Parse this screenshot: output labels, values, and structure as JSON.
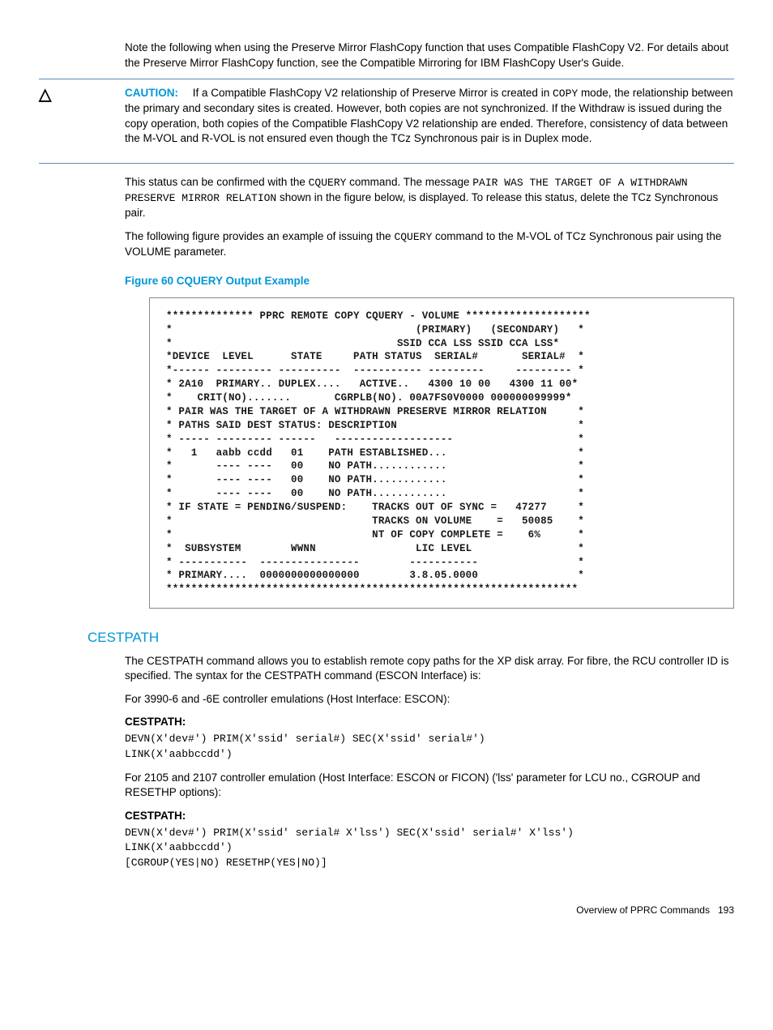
{
  "intro_para": "Note the following when using the Preserve Mirror FlashCopy function that uses Compatible FlashCopy V2. For details about the Preserve Mirror FlashCopy function, see the Compatible Mirroring for IBM FlashCopy User's Guide.",
  "caution": {
    "label": "CAUTION:",
    "pre_text": "If a Compatible FlashCopy V2 relationship of Preserve Mirror is created in ",
    "code": "COPY",
    "post_text": " mode, the relationship between the primary and secondary sites is created. However, both copies are not synchronized. If the Withdraw is issued during the copy operation, both copies of the Compatible FlashCopy V2 relationship are ended. Therefore, consistency of data between the M-VOL and R-VOL is not ensured even though the TCz Synchronous pair is in Duplex mode."
  },
  "status_para": {
    "t1": "This status can be confirmed with the ",
    "c1": "CQUERY",
    "t2": " command. The message ",
    "c2": "PAIR WAS THE TARGET OF A WITHDRAWN PRESERVE MIRROR RELATION",
    "t3": " shown in the figure below, is displayed. To release this status, delete the TCz Synchronous pair."
  },
  "example_para": {
    "t1": "The following figure provides an example of issuing the ",
    "c1": "CQUERY",
    "t2": " command to the M-VOL of TCz Synchronous pair using the VOLUME parameter."
  },
  "figure_caption": "Figure 60 CQUERY Output Example",
  "figure_body": "************** PPRC REMOTE COPY CQUERY - VOLUME ********************\n*                                       (PRIMARY)   (SECONDARY)   *\n*                                    SSID CCA LSS SSID CCA LSS*\n*DEVICE  LEVEL      STATE     PATH STATUS  SERIAL#       SERIAL#  *\n*------ --------- ----------  ----------- ---------     --------- *\n* 2A10  PRIMARY.. DUPLEX....   ACTIVE..   4300 10 00   4300 11 00*\n*    CRIT(NO).......       CGRPLB(NO). 00A7FS0V0000 000000099999*\n* PAIR WAS THE TARGET OF A WITHDRAWN PRESERVE MIRROR RELATION     *\n* PATHS SAID DEST STATUS: DESCRIPTION                             *\n* ----- --------- ------   -------------------                    *\n*   1   aabb ccdd   01    PATH ESTABLISHED...                     *\n*       ---- ----   00    NO PATH............                     *\n*       ---- ----   00    NO PATH............                     *\n*       ---- ----   00    NO PATH............                     *\n* IF STATE = PENDING/SUSPEND:    TRACKS OUT OF SYNC =   47277     *\n*                                TRACKS ON VOLUME    =   50085    *\n*                                NT OF COPY COMPLETE =    6%      *\n*  SUBSYSTEM        WWNN                LIC LEVEL                 *\n* -----------  ----------------        -----------                *\n* PRIMARY....  0000000000000000        3.8.05.0000                *\n******************************************************************",
  "cestpath_title": "CESTPATH",
  "cestpath_intro": "The CESTPATH command allows you to establish remote copy paths for the XP disk array. For fibre, the RCU controller ID is specified. The syntax for the CESTPATH command (ESCON Interface) is:",
  "escon_line": "For 3990-6 and -6E controller emulations (Host Interface: ESCON):",
  "cestpath_label": "CESTPATH:",
  "escon_syntax": "DEVN(X'dev#') PRIM(X'ssid' serial#) SEC(X'ssid' serial#')\nLINK(X'aabbccdd')",
  "ficon_line": "For 2105 and 2107 controller emulation (Host Interface: ESCON or FICON) ('lss' parameter for LCU no., CGROUP and RESETHP options):",
  "ficon_syntax": "DEVN(X'dev#') PRIM(X'ssid' serial# X'lss') SEC(X'ssid' serial#' X'lss')\nLINK(X'aabbccdd')\n[CGROUP(YES|NO) RESETHP(YES|NO)]",
  "footer_text": "Overview of PPRC Commands",
  "footer_page": "193"
}
